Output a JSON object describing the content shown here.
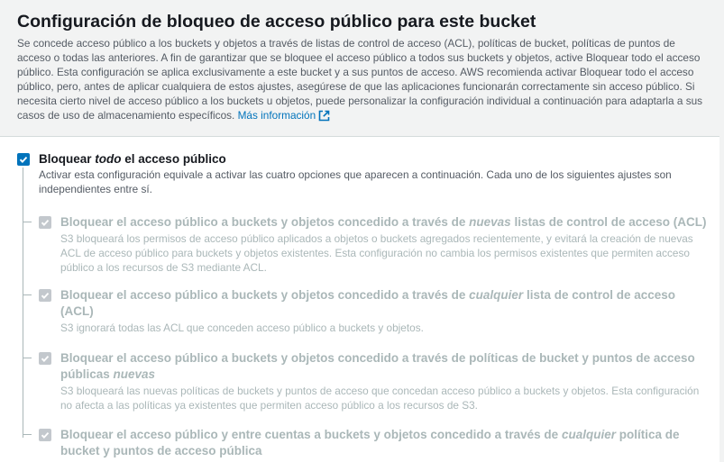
{
  "section": {
    "title": "Configuración de bloqueo de acceso público para este bucket",
    "description": "Se concede acceso público a los buckets y objetos a través de listas de control de acceso (ACL), políticas de bucket, políticas de puntos de acceso o todas las anteriores. A fin de garantizar que se bloquee el acceso público a todos sus buckets y objetos, active Bloquear todo el acceso público. Esta configuración se aplica exclusivamente a este bucket y a sus puntos de acceso. AWS recomienda activar Bloquear todo el acceso público, pero, antes de aplicar cualquiera de estos ajustes, asegúrese de que las aplicaciones funcionarán correctamente sin acceso público. Si necesita cierto nivel de acceso público a los buckets u objetos, puede personalizar la configuración individual a continuación para adaptarla a sus casos de uso de almacenamiento específicos.",
    "more_info_link": "Más información",
    "external_icon": "external-link-icon"
  },
  "block_all": {
    "label_prefix": "Bloquear ",
    "label_emphasis": "todo",
    "label_suffix": " el acceso público",
    "checked": true,
    "description": "Activar esta configuración equivale a activar las cuatro opciones que aparecen a continuación. Cada uno de los siguientes ajustes son independientes entre sí."
  },
  "options": [
    {
      "label_prefix": "Bloquear el acceso público a buckets y objetos concedido a través de ",
      "label_emphasis": "nuevas",
      "label_suffix": " listas de control de acceso (ACL)",
      "checked": true,
      "disabled": true,
      "description": "S3 bloqueará los permisos de acceso público aplicados a objetos o buckets agregados recientemente, y evitará la creación de nuevas ACL de acceso público para buckets y objetos existentes. Esta configuración no cambia los permisos existentes que permiten acceso público a los recursos de S3 mediante ACL."
    },
    {
      "label_prefix": "Bloquear el acceso público a buckets y objetos concedido a través de ",
      "label_emphasis": "cualquier",
      "label_suffix": " lista de control de acceso (ACL)",
      "checked": true,
      "disabled": true,
      "description": "S3 ignorará todas las ACL que conceden acceso público a buckets y objetos."
    },
    {
      "label_prefix": "Bloquear el acceso público a buckets y objetos concedido a través de políticas de bucket y puntos de acceso públicas ",
      "label_emphasis": "nuevas",
      "label_suffix": "",
      "checked": true,
      "disabled": true,
      "description": "S3 bloqueará las nuevas políticas de buckets y puntos de acceso que concedan acceso público a buckets y objetos. Esta configuración no afecta a las políticas ya existentes que permiten acceso público a los recursos de S3."
    },
    {
      "label_prefix": "Bloquear el acceso público y entre cuentas a buckets y objetos concedido a través de ",
      "label_emphasis": "cualquier",
      "label_suffix": " política de bucket y puntos de acceso pública",
      "checked": true,
      "disabled": true,
      "description": ""
    }
  ],
  "colors": {
    "accent": "#0073bb",
    "disabled": "#aab7b8",
    "header_bg": "#f2f3f3"
  }
}
